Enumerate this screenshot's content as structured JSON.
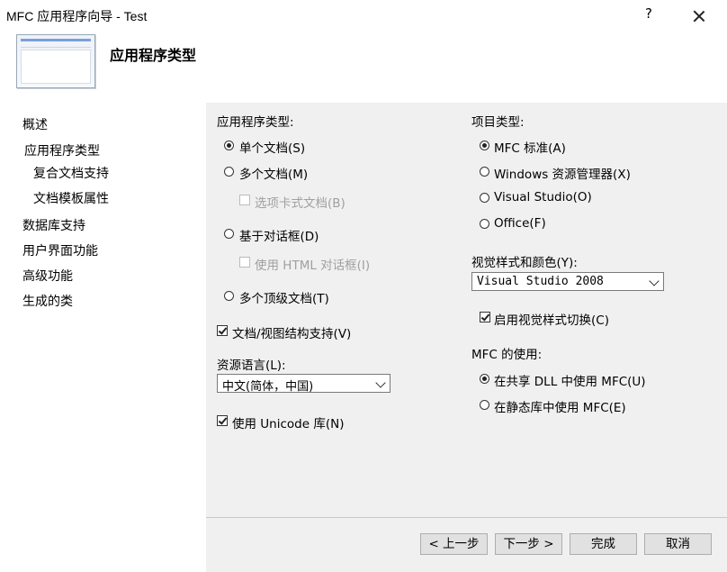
{
  "window": {
    "title": "MFC 应用程序向导 - Test",
    "help": "?",
    "close_icon": "close-icon"
  },
  "header": {
    "title": "应用程序类型"
  },
  "nav": {
    "items": [
      "概述",
      "应用程序类型",
      "复合文档支持",
      "文档模板属性",
      "数据库支持",
      "用户界面功能",
      "高级功能",
      "生成的类"
    ],
    "selected": "应用程序类型"
  },
  "app_type": {
    "label": "应用程序类型:",
    "single": "单个文档(S)",
    "multiple": "多个文档(M)",
    "tabbed": "选项卡式文档(B)",
    "dialog": "基于对话框(D)",
    "html_dialog": "使用 HTML 对话框(I)",
    "toplevel": "多个顶级文档(T)",
    "selected": "单个文档(S)"
  },
  "doc_view": {
    "label": "文档/视图结构支持(V)",
    "checked": true
  },
  "resource_lang": {
    "label": "资源语言(L):",
    "value": "中文(简体，中国)"
  },
  "unicode": {
    "label": "使用 Unicode 库(N)",
    "checked": true
  },
  "project_type": {
    "label": "项目类型:",
    "mfc": "MFC 标准(A)",
    "explorer": "Windows 资源管理器(X)",
    "vs": "Visual Studio(O)",
    "office": "Office(F)",
    "selected": "MFC 标准(A)"
  },
  "visual_style": {
    "label": "视觉样式和颜色(Y):",
    "value": "Visual Studio 2008"
  },
  "style_switch": {
    "label": "启用视觉样式切换(C)",
    "checked": true
  },
  "mfc_use": {
    "label": "MFC 的使用:",
    "shared": "在共享 DLL 中使用 MFC(U)",
    "static": "在静态库中使用 MFC(E)",
    "selected": "在共享 DLL 中使用 MFC(U)"
  },
  "buttons": {
    "prev": "< 上一步",
    "next": "下一步 >",
    "finish": "完成",
    "cancel": "取消"
  }
}
